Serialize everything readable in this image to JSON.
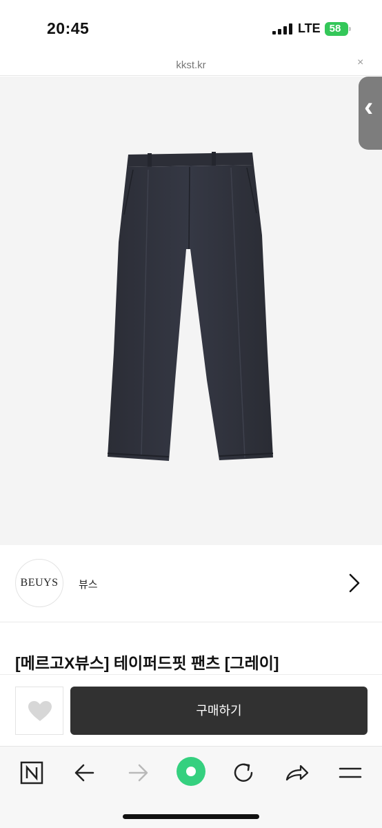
{
  "status_bar": {
    "time": "20:45",
    "network": "LTE",
    "battery": "58",
    "battery_color": "#34c759"
  },
  "url_bar": {
    "url": "kkst.kr",
    "close_icon": "×"
  },
  "product": {
    "image_alt": "gray tapered-fit pants",
    "title": "[메르고X뷰스] 테이퍼드핏 팬츠 [그레이]"
  },
  "brand": {
    "logo_text": "BEUYS",
    "name": "뷰스"
  },
  "actions": {
    "like_icon": "heart-icon",
    "buy_label": "구매하기"
  },
  "toolbar": {
    "items": [
      "naver-home-icon",
      "back-arrow-icon",
      "forward-arrow-icon",
      "green-circle-icon",
      "reload-icon",
      "share-icon",
      "menu-icon"
    ],
    "accent": "#35d07f"
  }
}
